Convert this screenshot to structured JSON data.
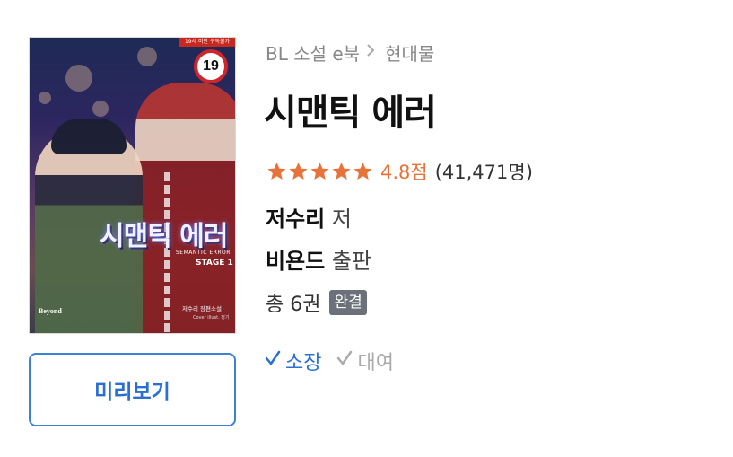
{
  "cover": {
    "age_banner": "19세 미만 구독불가",
    "age_badge": "19",
    "title_art": "시맨틱 에러",
    "subtitle_en": "SEMANTIC ERROR",
    "stage": "STAGE 1",
    "publisher_logo": "Beyond",
    "author_text": "저수리 장편소설",
    "credit_text": "Cover illust. 정기"
  },
  "preview_button": {
    "label": "미리보기"
  },
  "breadcrumb": {
    "category": "BL 소설 e북",
    "subcategory": "현대물"
  },
  "book": {
    "title": "시맨틱 에러",
    "rating_score": "4.8점",
    "rating_count": "(41,471명)",
    "stars": 5,
    "author_name": "저수리",
    "author_role": "저",
    "publisher_name": "비욘드",
    "publisher_role": "출판",
    "volumes": "총 6권",
    "status_badge": "완결"
  },
  "options": [
    {
      "label": "소장",
      "selected": true
    },
    {
      "label": "대여",
      "selected": false
    }
  ],
  "colors": {
    "accent_blue": "#2a6fd1",
    "star_orange": "#e8733a",
    "badge_gray": "#6b7079"
  }
}
